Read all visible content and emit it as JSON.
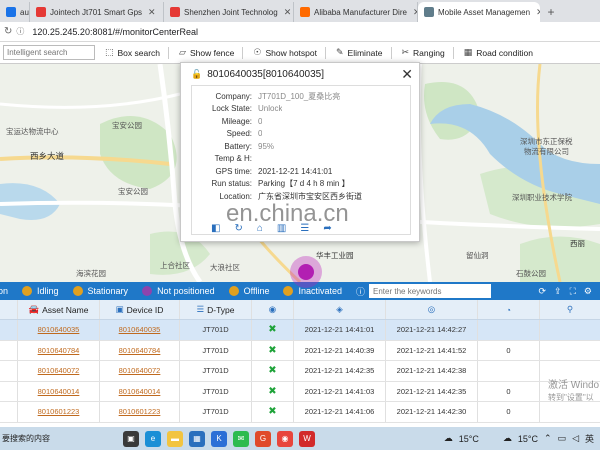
{
  "browser": {
    "tabs": [
      {
        "label": "aufa",
        "fav_color": "#1a73e8"
      },
      {
        "label": "Jointech Jt701 Smart Gps",
        "fav_color": "#e53935"
      },
      {
        "label": "Shenzhen Joint Technolog",
        "fav_color": "#e53935"
      },
      {
        "label": "Alibaba Manufacturer Dire",
        "fav_color": "#ff6a00"
      },
      {
        "label": "Mobile Asset Managemen",
        "fav_color": "#607d8b",
        "active": true
      }
    ],
    "new_tab": "+",
    "url": "120.25.245.20:8081/#/monitorCenterReal"
  },
  "map_toolbar": {
    "search_placeholder": "Intelligent search",
    "tools": [
      "Box search",
      "Show fence",
      "Show hotspot",
      "Eliminate",
      "Ranging",
      "Road condition"
    ]
  },
  "map_labels": [
    {
      "text": "宝运达物流中心"
    },
    {
      "text": "宝安公园"
    },
    {
      "text": "西乡大道"
    },
    {
      "text": "宝安公园"
    },
    {
      "text": "深圳市东正保税"
    },
    {
      "text": "物流有限公司"
    },
    {
      "text": "深圳职业技术学院"
    },
    {
      "text": "华丰工业园"
    },
    {
      "text": "上合社区"
    },
    {
      "text": "大浪社区"
    },
    {
      "text": "海滨花园"
    },
    {
      "text": "留仙洞"
    },
    {
      "text": "西丽"
    },
    {
      "text": "石鼓公园"
    }
  ],
  "popup": {
    "title": "8010640035[8010640035]",
    "close": "✕",
    "rows": [
      {
        "key": "Company:",
        "value": "JT701D_100_夏桑比亮"
      },
      {
        "key": "Lock State:",
        "value": "Unlock"
      },
      {
        "key": "Mileage:",
        "value": "0"
      },
      {
        "key": "Speed:",
        "value": "0"
      },
      {
        "key": "Battery:",
        "value": "95%"
      },
      {
        "key": "Temp & H:",
        "value": ""
      },
      {
        "key": "GPS time:",
        "value": "2021-12-21 14:41:01"
      },
      {
        "key": "Run status:",
        "value": "Parking【7 d 4 h 8 min 】"
      },
      {
        "key": "Location:",
        "value": "广东省深圳市宝安区西乡街道"
      }
    ]
  },
  "watermark": "en.china.cn",
  "status_bar": {
    "items": [
      {
        "label": "on",
        "color": ""
      },
      {
        "label": "Idling",
        "color": "#e0a020"
      },
      {
        "label": "Stationary",
        "color": "#e0a020"
      },
      {
        "label": "Not positioned",
        "color": "#8e44ad"
      },
      {
        "label": "Offline",
        "color": "#e0a020"
      },
      {
        "label": "Inactivated",
        "color": "#e0a020"
      }
    ],
    "search_placeholder": "Enter the keywords"
  },
  "table": {
    "headers": [
      "Asset Name",
      "Device ID",
      "D-Type",
      "",
      "",
      "",
      "",
      ""
    ],
    "rows": [
      {
        "asset": "8010640035",
        "device": "8010640035",
        "type": "JT701D",
        "t1": "2021-12-21 14:41:01",
        "t2": "2021-12-21 14:42:27",
        "selected": true
      },
      {
        "asset": "8010640784",
        "device": "8010640784",
        "type": "JT701D",
        "t1": "2021-12-21 14:40:39",
        "t2": "2021-12-21 14:41:52",
        "selected": false
      },
      {
        "asset": "8010640072",
        "device": "8010640072",
        "type": "JT701D",
        "t1": "2021-12-21 14:42:35",
        "t2": "2021-12-21 14:42:38",
        "selected": false
      },
      {
        "asset": "8010640014",
        "device": "8010640014",
        "type": "JT701D",
        "t1": "2021-12-21 14:41:03",
        "t2": "2021-12-21 14:42:35",
        "selected": false
      },
      {
        "asset": "8010601223",
        "device": "8010601223",
        "type": "JT701D",
        "t1": "2021-12-21 14:41:06",
        "t2": "2021-12-21 14:42:30",
        "selected": false
      }
    ],
    "row_extra": [
      "",
      "0",
      "",
      "0",
      "0"
    ]
  },
  "activate": {
    "line1": "激活 Windo",
    "line2": "转到\"设置\"以"
  },
  "taskbar": {
    "search_text": "要搜索的内容",
    "weather1": "15°C",
    "weather2": "15°C",
    "lang": "英"
  }
}
